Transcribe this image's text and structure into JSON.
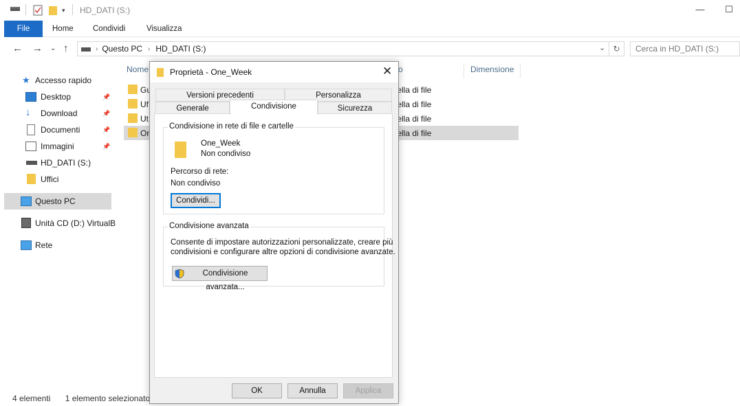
{
  "window": {
    "title": "HD_DATI (S:)",
    "minimize_glyph": "—",
    "maximize_glyph": "☐"
  },
  "ribbon": {
    "tabs": [
      "File",
      "Home",
      "Condividi",
      "Visualizza"
    ]
  },
  "addressbar": {
    "path": [
      "Questo PC",
      "HD_DATI (S:)"
    ],
    "search_placeholder": "Cerca in HD_DATI (S:)"
  },
  "navpane": {
    "quick_access": "Accesso rapido",
    "items": [
      "Desktop",
      "Download",
      "Documenti",
      "Immagini",
      "HD_DATI (S:)",
      "Uffici"
    ],
    "this_pc": "Questo PC",
    "cd_drive": "Unità CD (D:) VirtualB",
    "network": "Rete"
  },
  "filelist": {
    "columns": [
      "Nome",
      "o",
      "Dimensione"
    ],
    "rows": [
      {
        "name": "Gu",
        "type": "rtella di file"
      },
      {
        "name": "Uf",
        "type": "rtella di file"
      },
      {
        "name": "Ut",
        "type": "rtella di file"
      },
      {
        "name": "On",
        "type": "rtella di file"
      }
    ]
  },
  "statusbar": {
    "count": "4 elementi",
    "selection": "1 elemento selezionato"
  },
  "dialog": {
    "title": "Proprietà - One_Week",
    "tabs_row1": [
      "Versioni precedenti",
      "Personalizza"
    ],
    "tabs_row2": [
      "Generale",
      "Condivisione",
      "Sicurezza"
    ],
    "network_sharing": {
      "group_title": "Condivisione in rete di file e cartelle",
      "folder_name": "One_Week",
      "share_state": "Non condiviso",
      "path_label": "Percorso di rete:",
      "path_value": "Non condiviso",
      "share_button": "Condividi..."
    },
    "advanced_sharing": {
      "group_title": "Condivisione avanzata",
      "description_line1": "Consente di impostare autorizzazioni personalizzate, creare più",
      "description_line2": "condivisioni e configurare altre opzioni di condivisione avanzate.",
      "button": "Condivisione avanzata..."
    },
    "buttons": {
      "ok": "OK",
      "cancel": "Annulla",
      "apply": "Applica"
    }
  }
}
